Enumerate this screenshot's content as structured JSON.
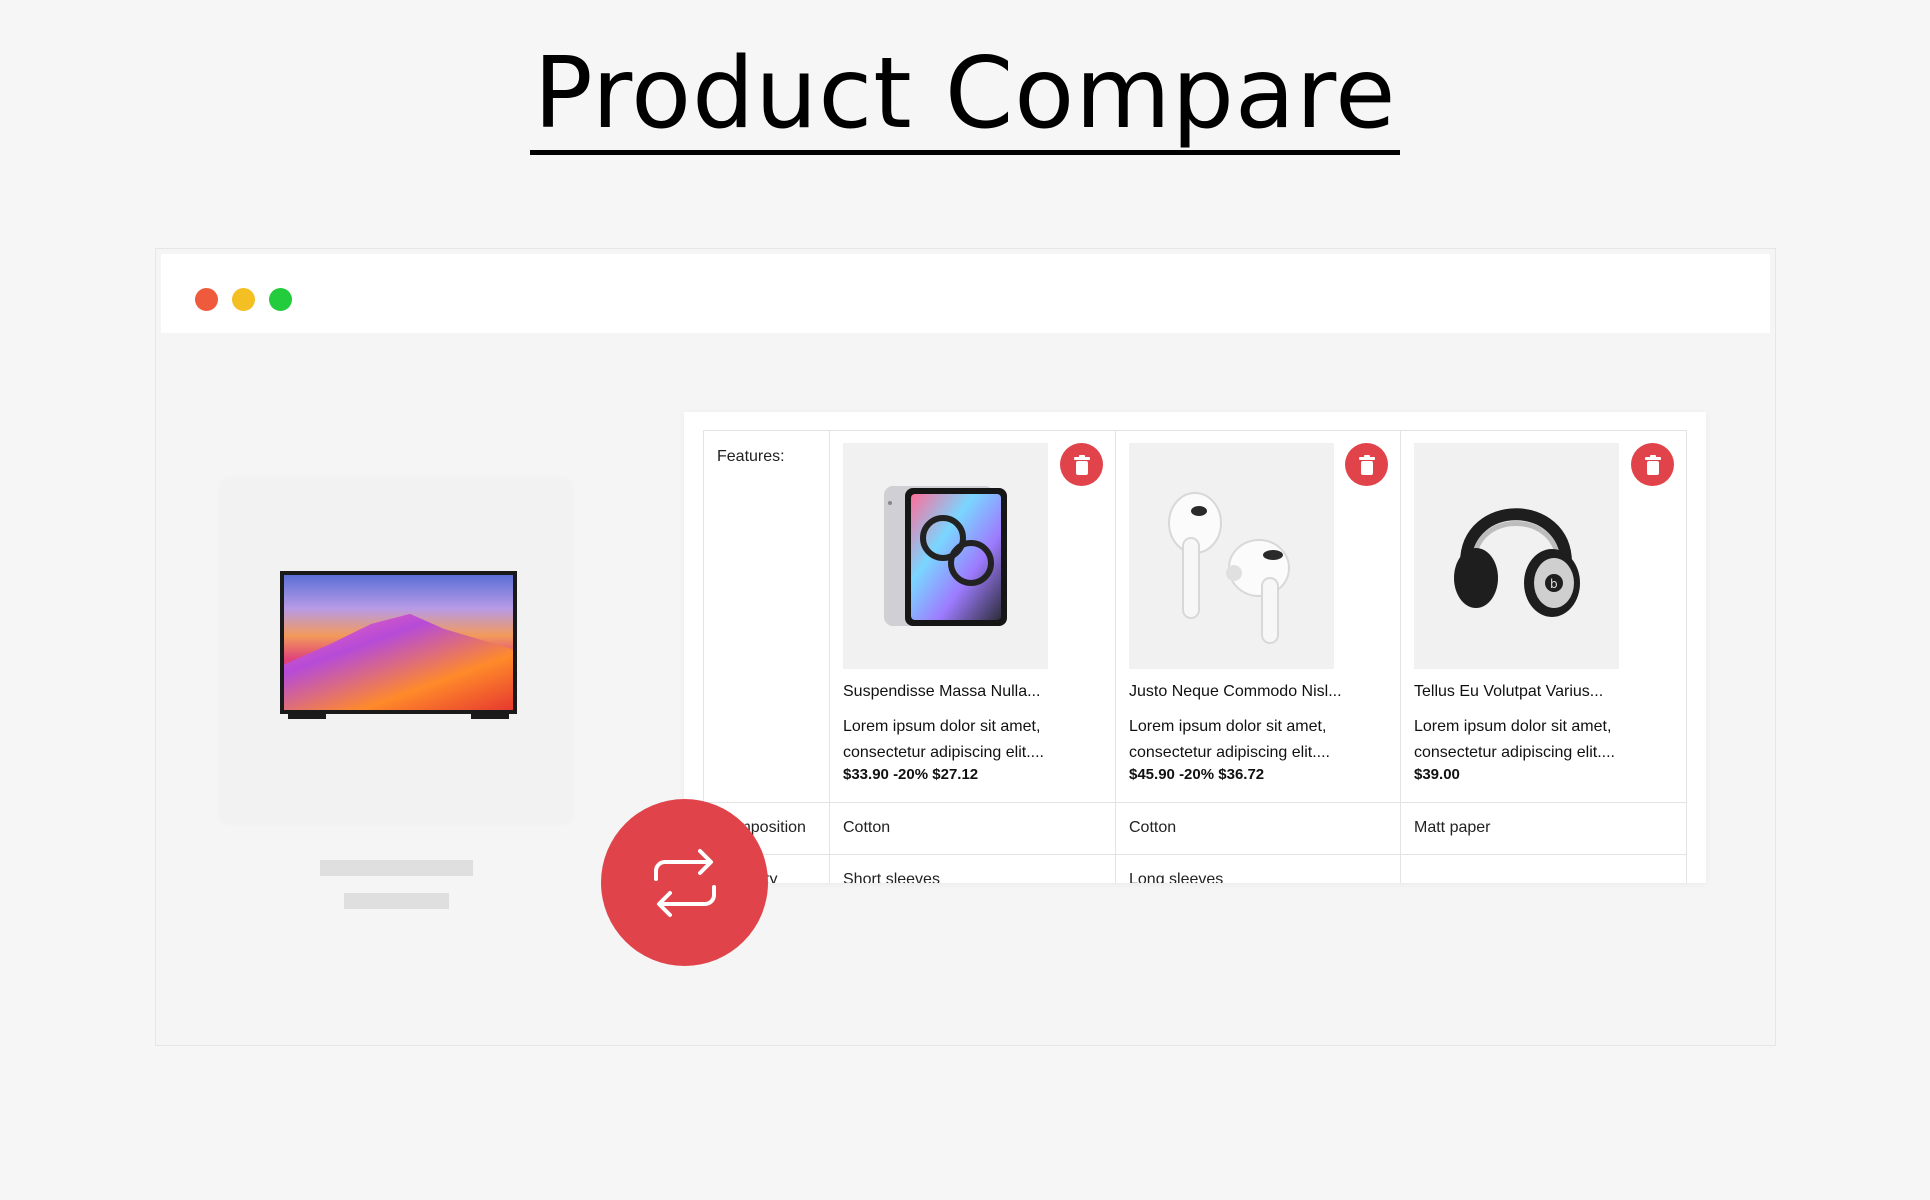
{
  "page": {
    "title": "Product Compare"
  },
  "browser": {
    "dots": [
      "#f05a3c",
      "#f4bf22",
      "#22cc3d"
    ]
  },
  "compare": {
    "features_label": "Features:",
    "products": [
      {
        "name": "Suspendisse Massa Nulla...",
        "description": "Lorem ipsum dolor sit amet, consectetur adipiscing elit....",
        "price_old": "$33.90",
        "discount": "-20%",
        "price_new": "$27.12",
        "image_icon": "tablet-icon"
      },
      {
        "name": "Justo Neque Commodo Nisl...",
        "description": "Lorem ipsum dolor sit amet, consectetur adipiscing elit....",
        "price_old": "$45.90",
        "discount": "-20%",
        "price_new": "$36.72",
        "image_icon": "earbuds-icon"
      },
      {
        "name": "Tellus Eu Volutpat Varius...",
        "description": "Lorem ipsum dolor sit amet, consectetur adipiscing elit....",
        "price": "$39.00",
        "image_icon": "headphones-icon"
      }
    ],
    "rows": [
      {
        "label": "Composition",
        "values": [
          "Cotton",
          "Cotton",
          "Matt paper"
        ]
      },
      {
        "label": "Property",
        "values": [
          "Short sleeves",
          "Long sleeves",
          ""
        ]
      }
    ]
  },
  "colors": {
    "accent": "#e0444a"
  }
}
